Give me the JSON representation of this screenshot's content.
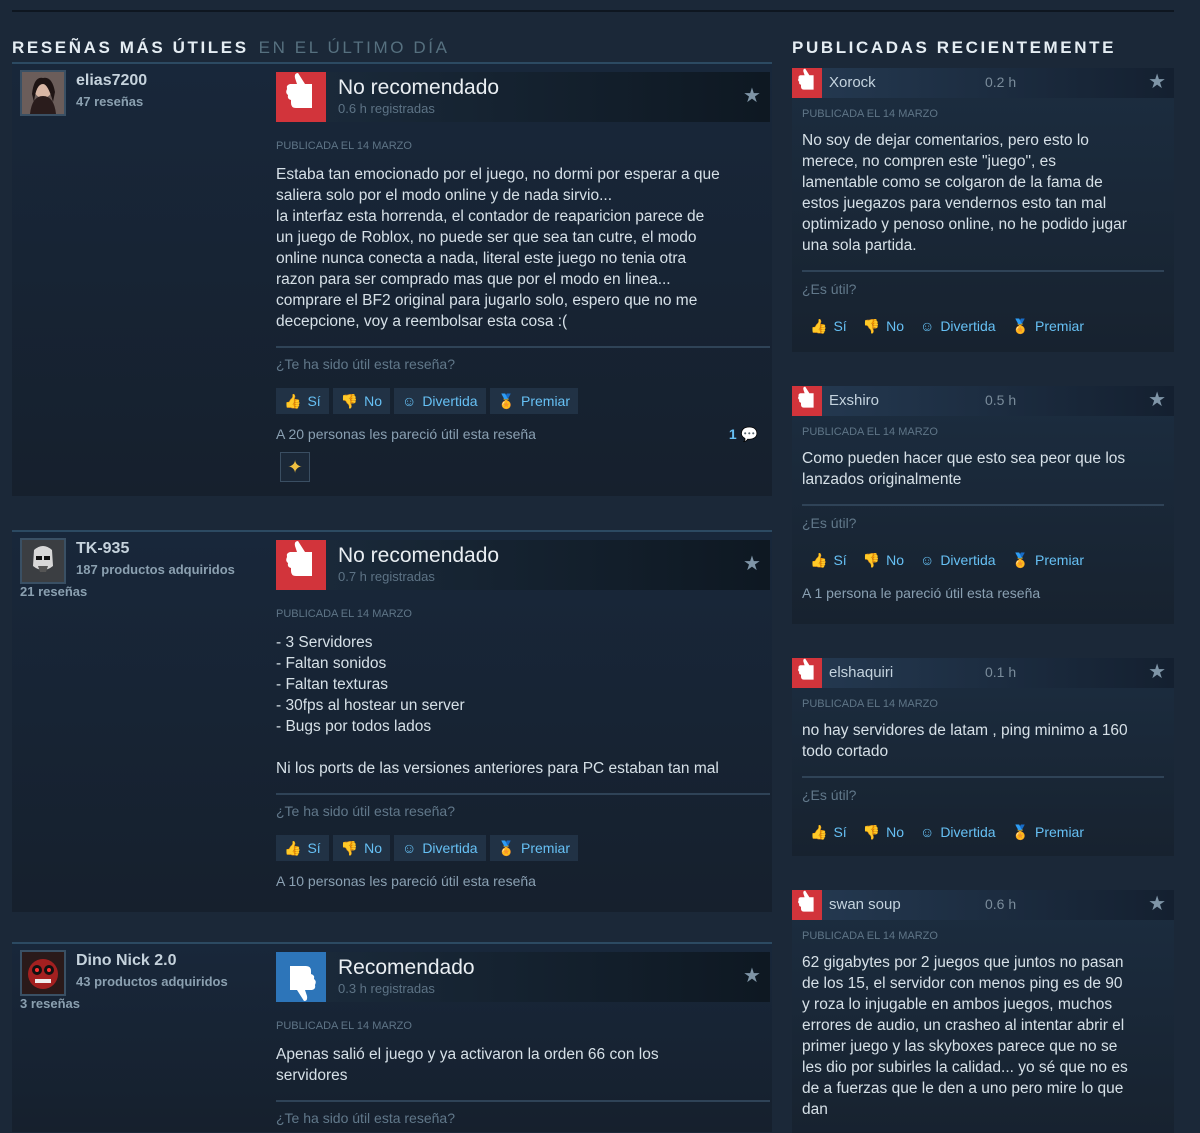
{
  "left_section": {
    "title": "RESEÑAS MÁS ÚTILES",
    "subtitle": "EN EL ÚLTIMO DÍA"
  },
  "right_section": {
    "title": "PUBLICADAS RECIENTEMENTE"
  },
  "labels": {
    "question_long": "¿Te ha sido útil esta reseña?",
    "question_short": "¿Es útil?",
    "yes": "Sí",
    "no": "No",
    "funny": "Divertida",
    "award": "Premiar",
    "posted": "PUBLICADA EL 14 MARZO"
  },
  "reviews": [
    {
      "author": "elias7200",
      "products": "",
      "count": "47 reseñas",
      "verdict": "No recomendado",
      "hours": "0.6 h registradas",
      "text_lines": [
        "Estaba tan emocionado por el juego, no dormi por esperar a que",
        "saliera solo por el modo online y de nada sirvio...",
        "la interfaz esta horrenda, el contador de reaparicion parece de",
        "un juego de Roblox, no puede ser que sea tan cutre, el modo",
        "online nunca conecta a nada, literal este juego no tenia otra",
        "razon para ser comprado mas que por el modo en linea...",
        "comprare el BF2 original para jugarlo solo, espero que no me",
        "decepcione, voy a reembolsar esta cosa :("
      ],
      "helpful": "A 20 personas les pareció útil esta reseña",
      "comments": "1"
    },
    {
      "author": "TK-935",
      "products": "187 productos adquiridos",
      "count": "21 reseñas",
      "verdict": "No recomendado",
      "hours": "0.7 h registradas",
      "text_lines": [
        "- 3 Servidores",
        "- Faltan sonidos",
        "- Faltan texturas",
        "- 30fps al hostear un server",
        "- Bugs por todos lados",
        "",
        "Ni los ports de las versiones anteriores para PC estaban tan mal"
      ],
      "helpful": "A 10 personas les pareció útil esta reseña"
    },
    {
      "author": "Dino Nick 2.0",
      "products": "43 productos adquiridos",
      "count": "3 reseñas",
      "verdict": "Recomendado",
      "hours": "0.3 h registradas",
      "text_lines": [
        "Apenas salió el juego y ya activaron la orden 66 con los",
        "servidores"
      ]
    }
  ],
  "recent": [
    {
      "author": "Xorock",
      "hours": "0.2 h",
      "text_lines": [
        "No soy de dejar comentarios, pero esto lo",
        "merece, no compren este \"juego\", es",
        "lamentable como se colgaron de la fama de",
        "estos juegazos para vendernos esto tan mal",
        "optimizado y penoso online, no he podido jugar",
        "una sola partida."
      ]
    },
    {
      "author": "Exshiro",
      "hours": "0.5 h",
      "text_lines": [
        "Como pueden hacer que esto sea peor que los",
        "lanzados originalmente"
      ],
      "helpful": "A 1 persona le pareció útil esta reseña"
    },
    {
      "author": "elshaquiri",
      "hours": "0.1 h",
      "text_lines": [
        "no hay servidores de latam , ping minimo a 160",
        "todo cortado"
      ]
    },
    {
      "author": "swan soup",
      "hours": "0.6 h",
      "text_lines": [
        "62 gigabytes por 2 juegos que juntos no pasan",
        "de los 15, el servidor con menos ping es de 90",
        "y roza lo injugable en ambos juegos, muchos",
        "errores de audio, un crasheo al intentar abrir el",
        "primer juego y las skyboxes parece que no se",
        "les dio por subirles la calidad... yo sé que no es",
        "de a fuerzas que le den a uno pero mire lo que",
        "dan"
      ]
    }
  ],
  "colors": {
    "background": "#1b2838",
    "accent": "#66c0f4",
    "thumbs_down": "#d2343b",
    "thumbs_up": "#2d75b9",
    "award_gold": "#ffc82c"
  }
}
